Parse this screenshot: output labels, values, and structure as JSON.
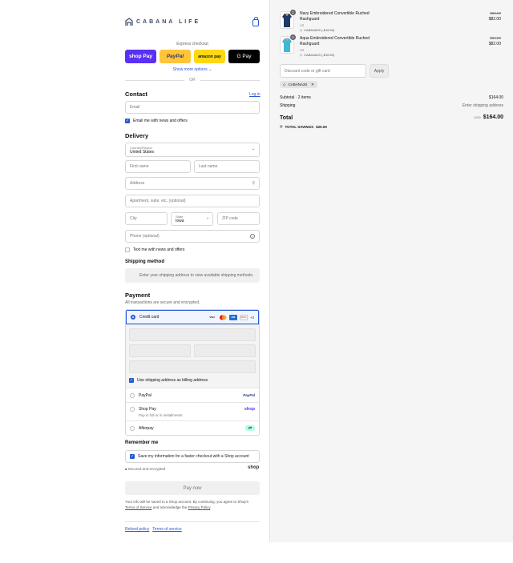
{
  "brand": {
    "logo_text": "CABANA LIFE"
  },
  "express": {
    "title": "Express checkout",
    "shop_pay": "shop Pay",
    "paypal": "PayPal",
    "amazon_pay": "amazon pay",
    "google_pay": "G Pay",
    "show_more": "Show more options",
    "or": "OR"
  },
  "contact": {
    "title": "Contact",
    "login": "Log in",
    "email_placeholder": "Email",
    "email_news": "Email me with news and offers"
  },
  "delivery": {
    "title": "Delivery",
    "country_label": "Country/Region",
    "country_value": "United States",
    "first_name": "First name",
    "last_name": "Last name",
    "address": "Address",
    "apartment": "Apartment, suite, etc. (optional)",
    "city": "City",
    "state_label": "State",
    "state_value": "Iowa",
    "zip": "ZIP code",
    "phone": "Phone (optional)",
    "text_news": "Text me with news and offers"
  },
  "shipping": {
    "title": "Shipping method",
    "placeholder": "Enter your shipping address to view available shipping methods."
  },
  "payment": {
    "title": "Payment",
    "subtitle": "All transactions are secure and encrypted.",
    "credit_card": "Credit card",
    "more_cards": "+3",
    "billing_same": "Use shipping address as billing address",
    "paypal": "PayPal",
    "shop_pay": "Shop Pay",
    "shop_pay_sub": "Pay in full or in installments",
    "afterpay": "Afterpay"
  },
  "remember": {
    "title": "Remember me",
    "save_info": "Save my information for a faster checkout with a Shop account",
    "secure": "Secured and encrypted",
    "shop_logo": "shop"
  },
  "pay_now": "Pay now",
  "legal": {
    "line1": "Your info will be saved to a Shop account. By continuing, you agree to Shop's",
    "terms": "Terms of Service",
    "and": "and acknowledge the",
    "privacy": "Privacy Policy",
    "period": "."
  },
  "footer": {
    "refund": "Refund policy",
    "terms": "Terms of service"
  },
  "order": {
    "items": [
      {
        "qty": "1",
        "name_line1": "Navy Embroidered Convertible Ruched",
        "name_line2": "Rashguard",
        "size": "XS",
        "discount": "CABANA20 (-$16.50)",
        "old_price": "$82.50",
        "price": "$82.00",
        "color": "#1f3a66"
      },
      {
        "qty": "1",
        "name_line1": "Aqua Embroidered Convertible Ruched",
        "name_line2": "Rashguard",
        "size": "XS",
        "discount": "CABANA20 (-$16.50)",
        "old_price": "$82.50",
        "price": "$82.00",
        "color": "#3fb8d6"
      }
    ],
    "discount_placeholder": "Discount code or gift card",
    "apply": "Apply",
    "code_tag": "CABANA20",
    "subtotal_label": "Subtotal · 2 items",
    "subtotal_value": "$164.00",
    "shipping_label": "Shipping",
    "shipping_value": "Enter shipping address",
    "total_label": "Total",
    "currency": "USD",
    "total_value": "$164.00",
    "savings_label": "TOTAL SAVINGS",
    "savings_value": "$20.00"
  },
  "colors": {
    "accent": "#2557d6",
    "shop_purple": "#5a31f4",
    "paypal_yellow": "#ffc439",
    "amazon_yellow": "#ffd814",
    "afterpay_mint": "#b2fce4"
  }
}
